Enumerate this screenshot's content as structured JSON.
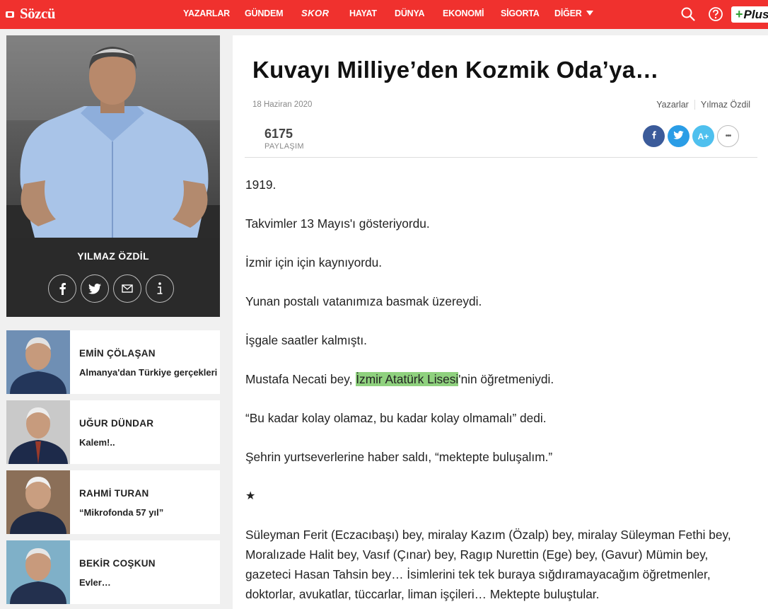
{
  "header": {
    "logo": "Sözcü",
    "nav": [
      "YAZARLAR",
      "GÜNDEM",
      "SKOR",
      "HAYAT",
      "DÜNYA",
      "EKONOMİ",
      "SİGORTA",
      "DİĞER"
    ],
    "plus_label": "Plus",
    "colors": {
      "bar": "#f0312e",
      "plus_accent": "#2e9e31"
    }
  },
  "author": {
    "name": "YILMAZ ÖZDİL",
    "social_icons": [
      "facebook-icon",
      "twitter-icon",
      "mail-icon",
      "info-icon"
    ]
  },
  "other_authors": [
    {
      "name": "EMİN ÇÖLAŞAN",
      "title": "Almanya'dan Türkiye gerçekleri"
    },
    {
      "name": "UĞUR DÜNDAR",
      "title": "Kalem!.."
    },
    {
      "name": "RAHMİ TURAN",
      "title": "“Mikrofonda 57 yıl”"
    },
    {
      "name": "BEKİR COŞKUN",
      "title": "Evler…"
    }
  ],
  "article": {
    "title": "Kuvayı Milliye’den Kozmik Oda’ya…",
    "date": "18 Haziran 2020",
    "breadcrumb": [
      "Yazarlar",
      "Yılmaz Özdil"
    ],
    "share_count": "6175",
    "share_label": "PAYLAŞIM",
    "share_buttons": {
      "font_size": "A+",
      "more": "•••"
    },
    "paragraphs": [
      "1919.",
      "Takvimler 13 Mayıs'ı gösteriyordu.",
      "İzmir için için kaynıyordu.",
      "Yunan postalı vatanımıza basmak üzereydi.",
      "İşgale saatler kalmıştı."
    ],
    "p6": {
      "before": "Mustafa Necati bey, ",
      "highlight": "İzmir Atatürk Lisesi",
      "after": "'nin öğretmeniydi."
    },
    "p7": "“Bu kadar kolay olamaz, bu kadar kolay olmamalı” dedi.",
    "p8": "Şehrin yurtseverlerine haber saldı, “mektepte buluşalım.”",
    "star": "★",
    "p9": "Süleyman Ferit (Eczacıbaşı) bey, miralay Kazım (Özalp) bey, miralay Süleyman Fethi bey, Moralızade Halit bey, Vasıf (Çınar) bey, Ragıp Nurettin (Ege) bey, (Gavur) Mümin bey, gazeteci Hasan Tahsin bey… İsimlerini tek tek buraya sığdıramayacağım öğretmenler, doktorlar, avukatlar, tüccarlar, liman işçileri… Mektepte buluştular."
  }
}
